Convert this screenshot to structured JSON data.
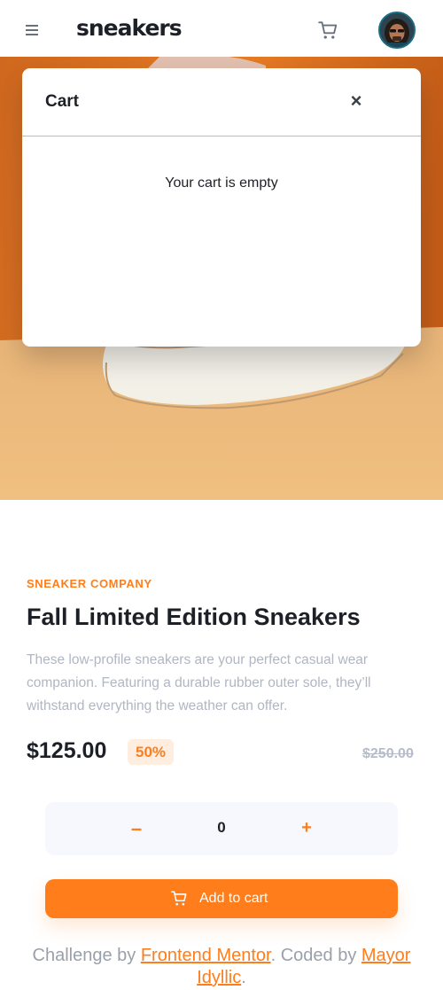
{
  "header": {
    "logo": "sneakers",
    "menu_icon": "hamburger-menu-icon",
    "cart_icon": "cart-icon",
    "avatar_icon": "user-avatar"
  },
  "cart": {
    "title": "Cart",
    "close_symbol": "×",
    "empty_text": "Your cart is empty"
  },
  "product": {
    "company": "SNEAKER COMPANY",
    "title": "Fall Limited Edition Sneakers",
    "description": "These low-profile sneakers are your perfect casual wear companion. Featuring a durable rubber outer sole, they’ll withstand everything the weather can offer.",
    "price": "$125.00",
    "discount": "50%",
    "original_price": "$250.00"
  },
  "quantity": {
    "minus": "–",
    "value": "0",
    "plus": "+"
  },
  "add_to_cart": {
    "label": "Add to cart",
    "icon": "cart-icon"
  },
  "attribution": {
    "prefix": "Challenge by ",
    "link1": "Frontend Mentor",
    "middle": ". Coded by ",
    "link2": "Mayor Idyllic",
    "suffix": "."
  },
  "colors": {
    "accent": "#ff7d1a",
    "accent_pale": "#ffede0",
    "text_dark": "#1d2026",
    "text_muted": "#b0b6c2",
    "qty_bg": "#f6f8fd"
  }
}
